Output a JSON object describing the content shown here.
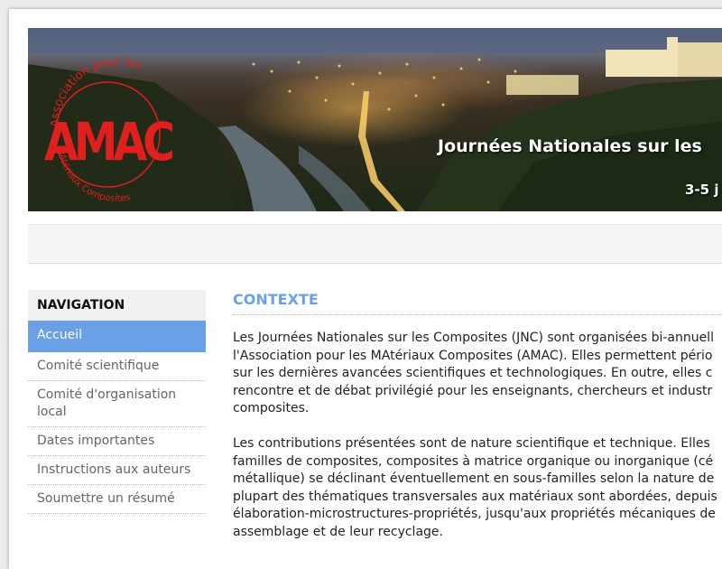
{
  "banner": {
    "logo": {
      "acronym": "AMAC",
      "arc_top": "Association pour les",
      "arc_bottom": "MAtériaux Composites"
    },
    "title": "Journées Nationales sur les",
    "dates": "3-5 j"
  },
  "colors": {
    "accent": "#6aa0e6",
    "logo_red": "#e0201e"
  },
  "sidebar": {
    "header": "NAVIGATION",
    "items": [
      {
        "label": "Accueil",
        "active": true
      },
      {
        "label": "Comité scientifique"
      },
      {
        "label": "Comité d'organisation local"
      },
      {
        "label": "Dates importantes"
      },
      {
        "label": "Instructions aux auteurs"
      },
      {
        "label": "Soumettre un résumé"
      }
    ]
  },
  "content": {
    "title": "CONTEXTE",
    "para1": [
      "Les Journées Nationales sur les Composites (JNC) sont organisées bi-annuell",
      "l'Association pour les MAtériaux Composites (AMAC). Elles permettent pério",
      "sur les dernières avancées scientifiques et technologiques. En outre, elles c",
      "rencontre et de débat privilégié pour les enseignants, chercheurs et industr",
      "composites."
    ],
    "para2": [
      "Les contributions présentées sont de nature scientifique et technique. Elles",
      "familles de composites, composites à matrice organique ou inorganique (cé",
      "métallique) se déclinant éventuellement en sous-familles selon la nature de",
      "plupart des thématiques transversales aux matériaux sont abordées, depuis",
      "élaboration-microstructures-propriétés, jusqu'aux propriétés mécaniques de",
      "assemblage et de leur recyclage."
    ]
  }
}
